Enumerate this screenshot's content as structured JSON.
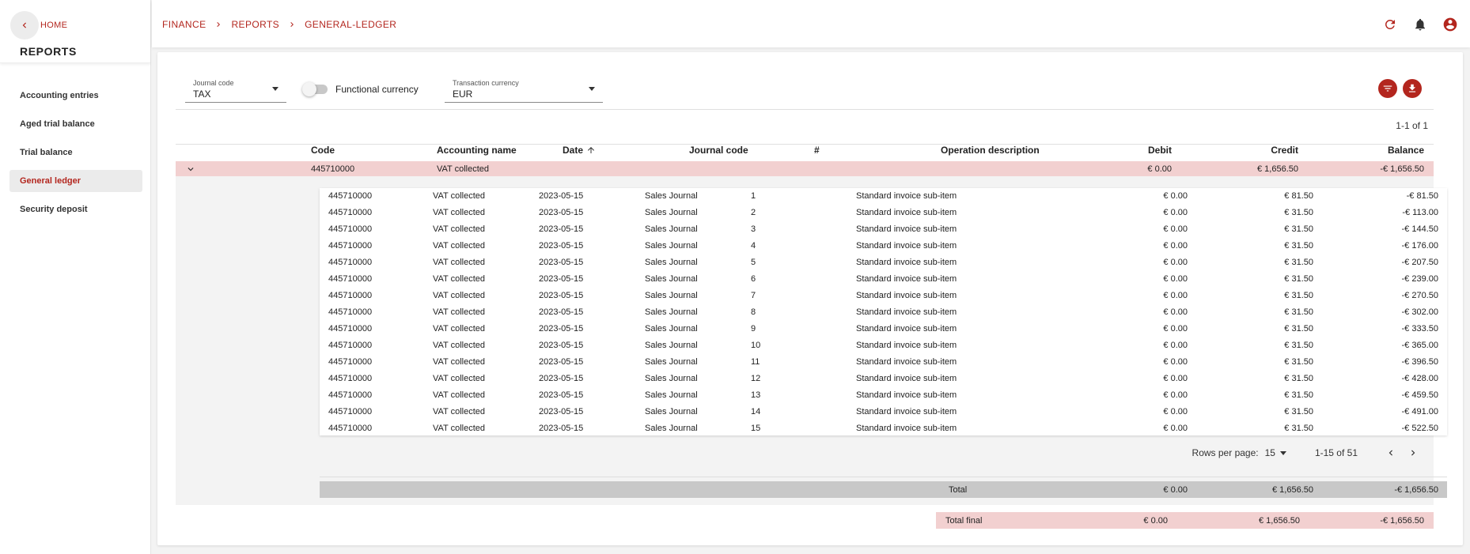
{
  "sidebar": {
    "home_label": "HOME",
    "title": "REPORTS",
    "items": [
      {
        "label": "Accounting entries",
        "active": false
      },
      {
        "label": "Aged trial balance",
        "active": false
      },
      {
        "label": "Trial balance",
        "active": false
      },
      {
        "label": "General ledger",
        "active": true
      },
      {
        "label": "Security deposit",
        "active": false
      }
    ]
  },
  "breadcrumb": [
    "FINANCE",
    "REPORTS",
    "GENERAL-LEDGER"
  ],
  "filters": {
    "journal_code": {
      "label": "Journal code",
      "value": "TAX"
    },
    "functional_currency": {
      "label": "Functional currency",
      "enabled": false
    },
    "transaction_currency": {
      "label": "Transaction currency",
      "value": "EUR"
    }
  },
  "range_text": "1-1 of 1",
  "columns": {
    "code": "Code",
    "name": "Accounting name",
    "date": "Date",
    "journal": "Journal code",
    "num": "#",
    "desc": "Operation description",
    "debit": "Debit",
    "credit": "Credit",
    "balance": "Balance"
  },
  "group": {
    "code": "445710000",
    "name": "VAT collected",
    "debit": "€ 0.00",
    "credit": "€ 1,656.50",
    "balance": "-€ 1,656.50"
  },
  "rows": [
    {
      "code": "445710000",
      "name": "VAT collected",
      "date": "2023-05-15",
      "journal": "Sales Journal",
      "num": "1",
      "desc": "Standard invoice sub-item",
      "debit": "€ 0.00",
      "credit": "€ 81.50",
      "balance": "-€ 81.50"
    },
    {
      "code": "445710000",
      "name": "VAT collected",
      "date": "2023-05-15",
      "journal": "Sales Journal",
      "num": "2",
      "desc": "Standard invoice sub-item",
      "debit": "€ 0.00",
      "credit": "€ 31.50",
      "balance": "-€ 113.00"
    },
    {
      "code": "445710000",
      "name": "VAT collected",
      "date": "2023-05-15",
      "journal": "Sales Journal",
      "num": "3",
      "desc": "Standard invoice sub-item",
      "debit": "€ 0.00",
      "credit": "€ 31.50",
      "balance": "-€ 144.50"
    },
    {
      "code": "445710000",
      "name": "VAT collected",
      "date": "2023-05-15",
      "journal": "Sales Journal",
      "num": "4",
      "desc": "Standard invoice sub-item",
      "debit": "€ 0.00",
      "credit": "€ 31.50",
      "balance": "-€ 176.00"
    },
    {
      "code": "445710000",
      "name": "VAT collected",
      "date": "2023-05-15",
      "journal": "Sales Journal",
      "num": "5",
      "desc": "Standard invoice sub-item",
      "debit": "€ 0.00",
      "credit": "€ 31.50",
      "balance": "-€ 207.50"
    },
    {
      "code": "445710000",
      "name": "VAT collected",
      "date": "2023-05-15",
      "journal": "Sales Journal",
      "num": "6",
      "desc": "Standard invoice sub-item",
      "debit": "€ 0.00",
      "credit": "€ 31.50",
      "balance": "-€ 239.00"
    },
    {
      "code": "445710000",
      "name": "VAT collected",
      "date": "2023-05-15",
      "journal": "Sales Journal",
      "num": "7",
      "desc": "Standard invoice sub-item",
      "debit": "€ 0.00",
      "credit": "€ 31.50",
      "balance": "-€ 270.50"
    },
    {
      "code": "445710000",
      "name": "VAT collected",
      "date": "2023-05-15",
      "journal": "Sales Journal",
      "num": "8",
      "desc": "Standard invoice sub-item",
      "debit": "€ 0.00",
      "credit": "€ 31.50",
      "balance": "-€ 302.00"
    },
    {
      "code": "445710000",
      "name": "VAT collected",
      "date": "2023-05-15",
      "journal": "Sales Journal",
      "num": "9",
      "desc": "Standard invoice sub-item",
      "debit": "€ 0.00",
      "credit": "€ 31.50",
      "balance": "-€ 333.50"
    },
    {
      "code": "445710000",
      "name": "VAT collected",
      "date": "2023-05-15",
      "journal": "Sales Journal",
      "num": "10",
      "desc": "Standard invoice sub-item",
      "debit": "€ 0.00",
      "credit": "€ 31.50",
      "balance": "-€ 365.00"
    },
    {
      "code": "445710000",
      "name": "VAT collected",
      "date": "2023-05-15",
      "journal": "Sales Journal",
      "num": "11",
      "desc": "Standard invoice sub-item",
      "debit": "€ 0.00",
      "credit": "€ 31.50",
      "balance": "-€ 396.50"
    },
    {
      "code": "445710000",
      "name": "VAT collected",
      "date": "2023-05-15",
      "journal": "Sales Journal",
      "num": "12",
      "desc": "Standard invoice sub-item",
      "debit": "€ 0.00",
      "credit": "€ 31.50",
      "balance": "-€ 428.00"
    },
    {
      "code": "445710000",
      "name": "VAT collected",
      "date": "2023-05-15",
      "journal": "Sales Journal",
      "num": "13",
      "desc": "Standard invoice sub-item",
      "debit": "€ 0.00",
      "credit": "€ 31.50",
      "balance": "-€ 459.50"
    },
    {
      "code": "445710000",
      "name": "VAT collected",
      "date": "2023-05-15",
      "journal": "Sales Journal",
      "num": "14",
      "desc": "Standard invoice sub-item",
      "debit": "€ 0.00",
      "credit": "€ 31.50",
      "balance": "-€ 491.00"
    },
    {
      "code": "445710000",
      "name": "VAT collected",
      "date": "2023-05-15",
      "journal": "Sales Journal",
      "num": "15",
      "desc": "Standard invoice sub-item",
      "debit": "€ 0.00",
      "credit": "€ 31.50",
      "balance": "-€ 522.50"
    }
  ],
  "pagination": {
    "rows_per_page_label": "Rows per page:",
    "rows_per_page": "15",
    "range": "1-15 of 51"
  },
  "total": {
    "label": "Total",
    "debit": "€ 0.00",
    "credit": "€ 1,656.50",
    "balance": "-€ 1,656.50"
  },
  "total_final": {
    "label": "Total final",
    "debit": "€ 0.00",
    "credit": "€ 1,656.50",
    "balance": "-€ 1,656.50"
  },
  "colors": {
    "accent": "#b3261e",
    "group_row": "#f2d0d0",
    "total_row": "#c8c8c8"
  },
  "icons": {
    "back": "chevron-left-icon",
    "refresh": "refresh-icon",
    "notifications": "bell-icon",
    "account": "account-circle-icon",
    "filter": "filter-icon",
    "download": "download-icon"
  }
}
